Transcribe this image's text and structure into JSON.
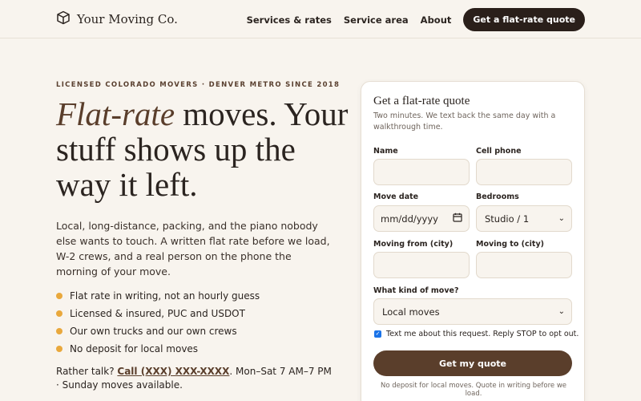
{
  "header": {
    "brand_name": "Your Moving Co.",
    "brand_icon": "box-icon",
    "nav": {
      "services": "Services & rates",
      "area": "Service area",
      "about": "About",
      "cta": "Get a flat-rate quote"
    }
  },
  "hero": {
    "eyebrow": "LICENSED COLORADO MOVERS · DENVER METRO SINCE 2018",
    "headline_accent": "Flat-rate",
    "headline_rest": " moves. Your stuff shows up the way it left.",
    "intro": "Local, long-distance, packing, and the piano nobody else wants to touch. A written flat rate before we load, W-2 crews, and a real person on the phone the morning of your move.",
    "features": [
      "Flat rate in writing, not an hourly guess",
      "Licensed & insured, PUC and USDOT",
      "Our own trucks and our own crews",
      "No deposit for local moves"
    ],
    "callout_prefix": "Rather talk? ",
    "callout_phone": "Call (XXX) XXX-XXXX",
    "callout_suffix": ". Mon–Sat 7 AM–7 PM · Sunday moves available."
  },
  "form": {
    "title": "Get a flat-rate quote",
    "subtitle": "Two minutes. We text back the same day with a walkthrough time.",
    "name_label": "Name",
    "phone_label": "Cell phone",
    "date_label": "Move date",
    "date_value": "mm/dd/yyyy",
    "bedrooms_label": "Bedrooms",
    "bedrooms_value": "Studio / 1",
    "from_label": "Moving from (city)",
    "to_label": "Moving to (city)",
    "kind_label": "What kind of move?",
    "kind_value": "Local moves",
    "consent": "Text me about this request. Reply STOP to opt out.",
    "consent_checked": true,
    "submit": "Get my quote",
    "fineprint": "No deposit for local moves. Quote in writing before we load."
  },
  "colors": {
    "accent": "#5a3e2b",
    "bullet": "#e9a83c",
    "dark_button": "#2a1f1a",
    "background": "#f8f4ee"
  }
}
